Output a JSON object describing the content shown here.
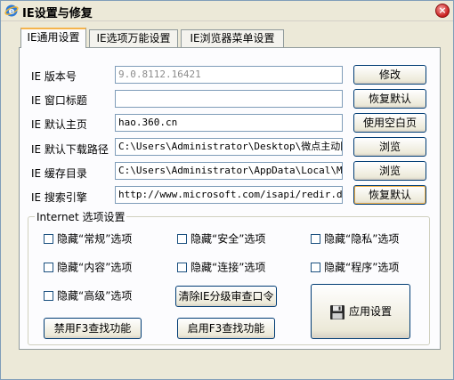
{
  "window": {
    "title": "IE设置与修复",
    "close_glyph": "×"
  },
  "tabs": [
    {
      "label": "IE通用设置",
      "active": true
    },
    {
      "label": "IE选项万能设置",
      "active": false
    },
    {
      "label": "IE浏览器菜单设置",
      "active": false
    }
  ],
  "fields": {
    "version": {
      "label": "IE 版本号",
      "value": "9.0.8112.16421",
      "button": "修改"
    },
    "window_title": {
      "label": "IE 窗口标题",
      "value": "",
      "button": "恢复默认"
    },
    "home_page": {
      "label": "IE 默认主页",
      "value": "hao.360.cn",
      "button": "使用空白页"
    },
    "download_path": {
      "label": "IE 默认下载路径",
      "value": "C:\\Users\\Administrator\\Desktop\\微点主动防御",
      "button": "浏览"
    },
    "cache_dir": {
      "label": "IE 缓存目录",
      "value": "C:\\Users\\Administrator\\AppData\\Local\\Microsoft",
      "button": "浏览"
    },
    "search_engine": {
      "label": "IE 搜索引擎",
      "value": "http://www.microsoft.com/isapi/redir.dll?prd",
      "button": "恢复默认"
    }
  },
  "internet_options": {
    "legend": "Internet 选项设置",
    "checkboxes": [
      {
        "label": "隐藏“常规”选项",
        "checked": false
      },
      {
        "label": "隐藏“安全”选项",
        "checked": false
      },
      {
        "label": "隐藏“隐私”选项",
        "checked": false
      },
      {
        "label": "隐藏“内容”选项",
        "checked": false
      },
      {
        "label": "隐藏“连接”选项",
        "checked": false
      },
      {
        "label": "隐藏“程序”选项",
        "checked": false
      },
      {
        "label": "隐藏“高级”选项",
        "checked": false
      }
    ],
    "clear_password_button": "清除IE分级审查口令",
    "disable_f3_button": "禁用F3查找功能",
    "enable_f3_button": "启用F3查找功能",
    "apply_button": "应用设置"
  },
  "icons": {
    "app": "ie-logo-icon",
    "apply": "floppy-disk-icon"
  }
}
